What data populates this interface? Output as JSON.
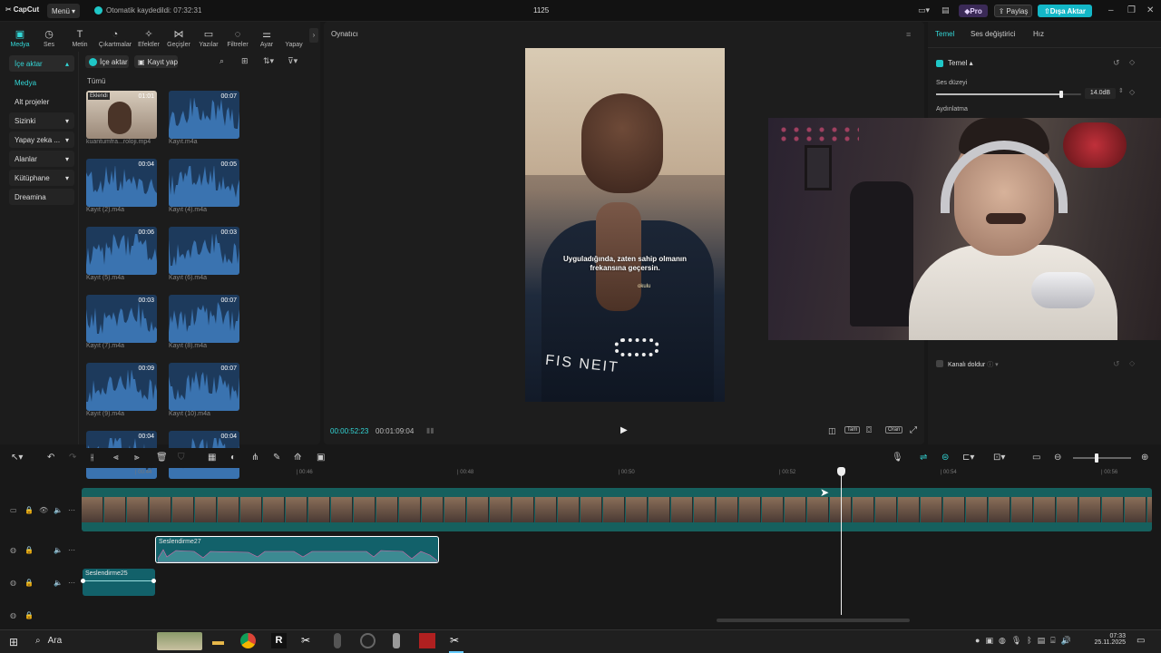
{
  "titlebar": {
    "app": "CapCut",
    "menu": "Menü",
    "autosave": "Otomatik kaydedildi: 07:32:31",
    "project": "1125",
    "pro": "Pro",
    "share": "Paylaş",
    "export": "Dışa Aktar"
  },
  "top_tabs": [
    {
      "label": "Medya",
      "icon": "media-icon"
    },
    {
      "label": "Ses",
      "icon": "audio-icon"
    },
    {
      "label": "Metin",
      "icon": "text-icon"
    },
    {
      "label": "Çıkartmalar",
      "icon": "sticker-icon"
    },
    {
      "label": "Efektler",
      "icon": "effects-icon"
    },
    {
      "label": "Geçişler",
      "icon": "transition-icon"
    },
    {
      "label": "Yazılar",
      "icon": "captions-icon"
    },
    {
      "label": "Filtreler",
      "icon": "filter-icon"
    },
    {
      "label": "Ayar",
      "icon": "adjust-icon"
    },
    {
      "label": "Yapay",
      "icon": "ai-icon"
    }
  ],
  "sidebar": {
    "items": [
      "İçe aktar",
      "Medya",
      "Alt projeler",
      "Sizinki",
      "Yapay zeka ...",
      "Alanlar",
      "Kütüphane",
      "Dreamina"
    ]
  },
  "media": {
    "import": "İçe aktar",
    "record": "Kayıt yap",
    "all": "Tümü",
    "added_badge": "Eklendi",
    "items": [
      {
        "name": "kuantumfra...roloji.mp4",
        "duration": "01:01",
        "video": true
      },
      {
        "name": "Kayıt.m4a",
        "duration": "00:07"
      },
      {
        "name": "Kayıt (2).m4a",
        "duration": "00:04"
      },
      {
        "name": "Kayıt (4).m4a",
        "duration": "00:05"
      },
      {
        "name": "Kayıt (5).m4a",
        "duration": "00:06"
      },
      {
        "name": "Kayıt (6).m4a",
        "duration": "00:03"
      },
      {
        "name": "Kayıt (7).m4a",
        "duration": "00:03"
      },
      {
        "name": "Kayıt (8).m4a",
        "duration": "00:07"
      },
      {
        "name": "Kayıt (9).m4a",
        "duration": "00:09"
      },
      {
        "name": "Kayıt (10).m4a",
        "duration": "00:07"
      },
      {
        "name": "",
        "duration": "00:04"
      },
      {
        "name": "",
        "duration": "00:04"
      }
    ]
  },
  "player": {
    "label": "Oynatıcı",
    "subtitle_line1": "Uyguladığında, zaten sahip olmanın",
    "subtitle_line2": "frekansına geçersin.",
    "watermark": "okulu",
    "shirt_text": "FIS NEIT",
    "current": "00:00:52:23",
    "total": "00:01:09:04",
    "full_label": "Tam",
    "ratio_label": "Oran"
  },
  "right": {
    "tabs": [
      "Temel",
      "Ses değiştirici",
      "Hız"
    ],
    "section": "Temel",
    "volume_label": "Ses düzeyi",
    "volume_value": "14.0dB",
    "volume_level": 0.86,
    "light_label": "Aydınlatma",
    "fill_channel": "Kanalı doldur"
  },
  "timeline": {
    "ticks": [
      "00:44",
      "00:46",
      "00:48",
      "00:50",
      "00:52",
      "00:54",
      "00:56"
    ],
    "clip_audio1": "Seslendirme27",
    "clip_audio2": "Seslendirme25"
  },
  "taskbar": {
    "search": "Ara",
    "time": "07:33",
    "date": "25.11.2025"
  }
}
